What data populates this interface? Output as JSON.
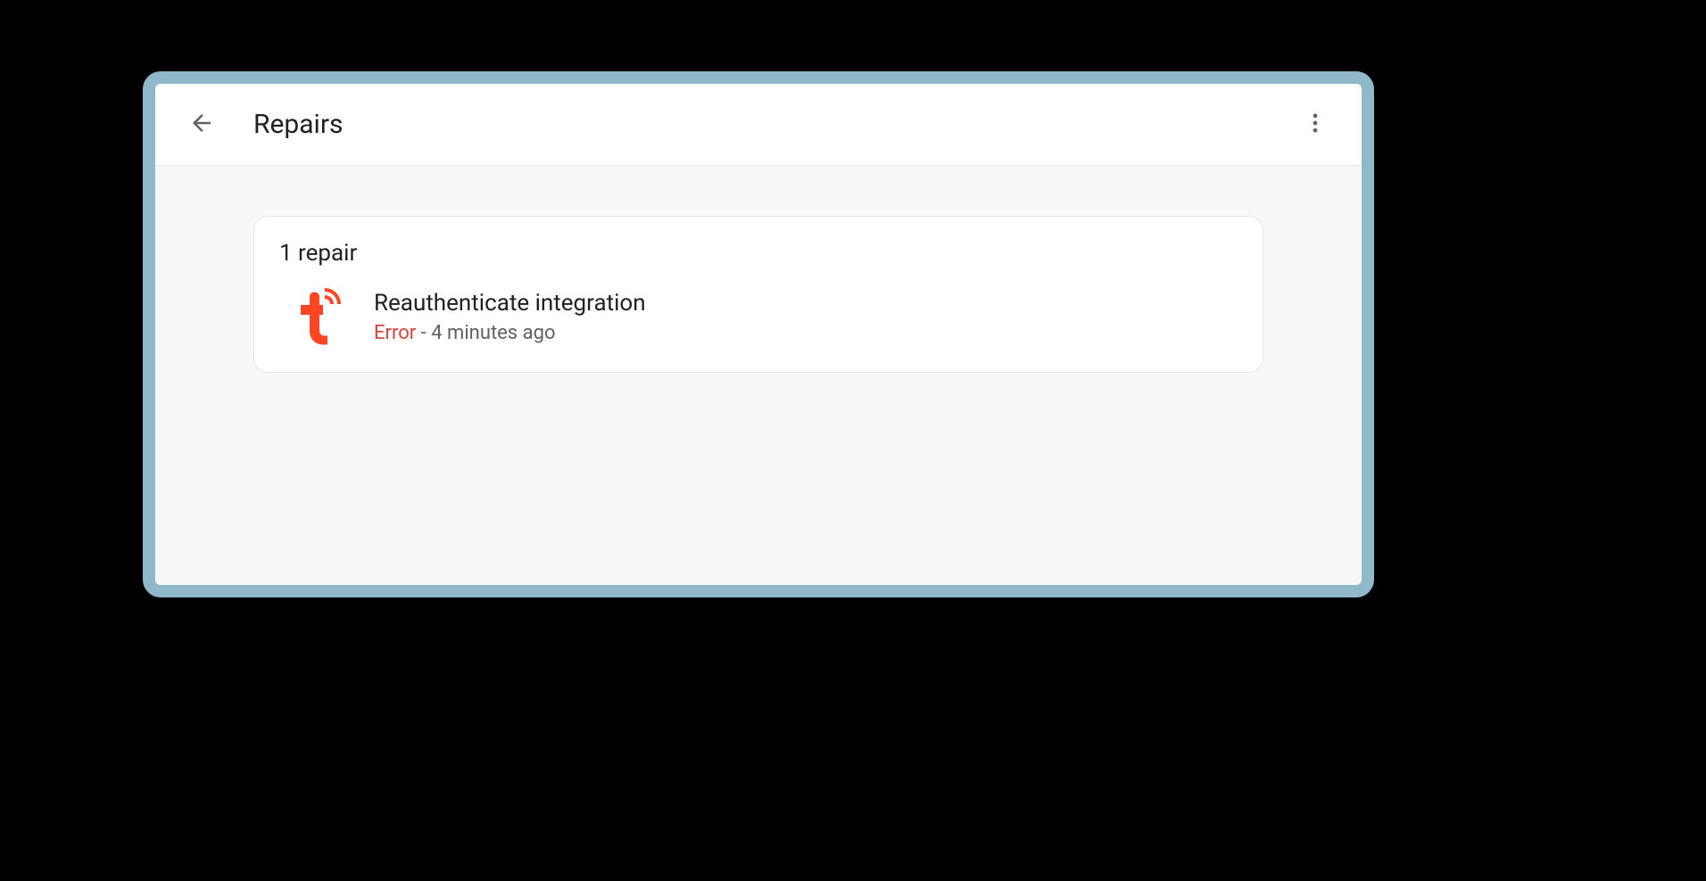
{
  "header": {
    "title": "Repairs"
  },
  "card": {
    "title": "1 repair"
  },
  "repair": {
    "title": "Reauthenticate integration",
    "status": "Error",
    "separator": " - ",
    "time": "4 minutes ago",
    "icon_name": "tuya"
  }
}
